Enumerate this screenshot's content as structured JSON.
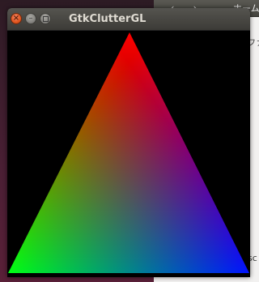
{
  "background_window": {
    "back_icon": "chevron-left-icon",
    "forward_icon": "chevron-right-icon",
    "home_icon": "home-icon",
    "home_label": "ホーム",
    "sidebar_text": "ファ",
    "bottom_text": "sc"
  },
  "window": {
    "title": "GtkClutterGL",
    "buttons": {
      "close_icon": "close-icon",
      "minimize_icon": "minimize-icon",
      "maximize_icon": "maximize-icon"
    }
  },
  "scene": {
    "shape": "triangle",
    "vertex_colors": {
      "top": "#ff0000",
      "bottom_left": "#00ff00",
      "bottom_right": "#0000ff"
    },
    "background": "#000000"
  }
}
